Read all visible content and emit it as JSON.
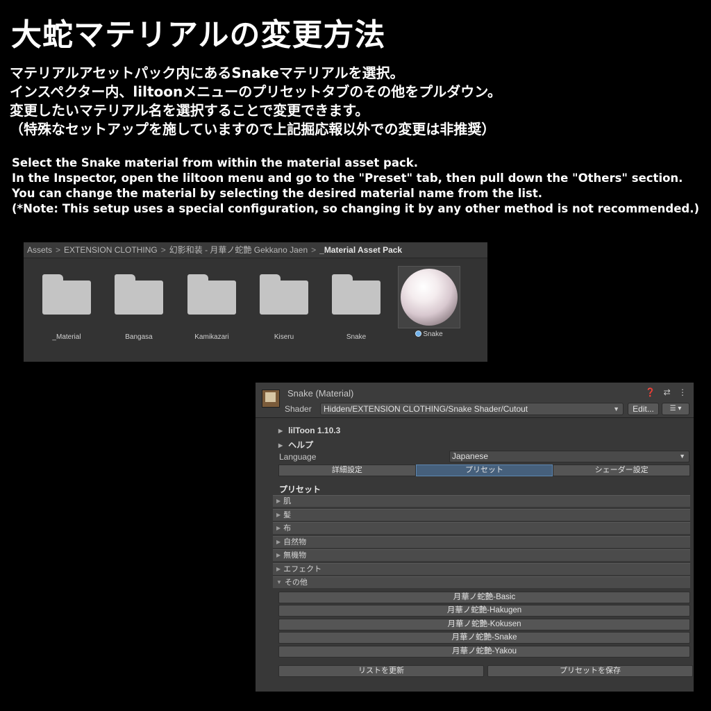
{
  "title": "大蛇マテリアルの変更方法",
  "jp_lines": [
    "マテリアルアセットパック内にあるSnakeマテリアルを選択。",
    "インスペクター内、liltoonメニューのプリセットタブのその他をプルダウン。",
    "変更したいマテリアル名を選択することで変更できます。",
    "（特殊なセットアップを施していますので上記掘応報以外での変更は非推奨）"
  ],
  "en_lines": [
    "Select the Snake material from within the material asset pack.",
    "In the Inspector, open the liltoon menu and go to the \"Preset\" tab, then pull down the \"Others\" section.",
    "You can change the material by selecting the desired material name from the list.",
    "(*Note: This setup uses a special configuration, so changing it by any other method is not recommended.)"
  ],
  "project": {
    "breadcrumb": [
      "Assets",
      "EXTENSION CLOTHING",
      "幻影和装 - 月華ノ蛇艶 Gekkano Jaen",
      "_Material Asset Pack"
    ],
    "separator": ">",
    "folders": [
      "_Material",
      "Bangasa",
      "Kamikazari",
      "Kiseru",
      "Snake"
    ],
    "material": "Snake"
  },
  "inspector": {
    "name": "Snake (Material)",
    "header_icons": "❓ ⇄ ⋮",
    "shader_label": "Shader",
    "shader_value": "Hidden/EXTENSION CLOTHING/Snake Shader/Cutout",
    "edit_label": "Edit...",
    "list_label": "☰ ▾",
    "foldouts": [
      "lilToon 1.10.3",
      "ヘルプ"
    ],
    "language_label": "Language",
    "language_value": "Japanese",
    "tabs": [
      "詳細設定",
      "プリセット",
      "シェーダー設定"
    ],
    "preset_title": "プリセット",
    "categories": [
      "肌",
      "髪",
      "布",
      "自然物",
      "無機物",
      "エフェクト",
      "その他"
    ],
    "presets": [
      "月華ノ蛇艶-Basic",
      "月華ノ蛇艶-Hakugen",
      "月華ノ蛇艶-Kokusen",
      "月華ノ蛇艶-Snake",
      "月華ノ蛇艶-Yakou"
    ],
    "refresh_label": "リストを更新",
    "save_label": "プリセットを保存"
  }
}
